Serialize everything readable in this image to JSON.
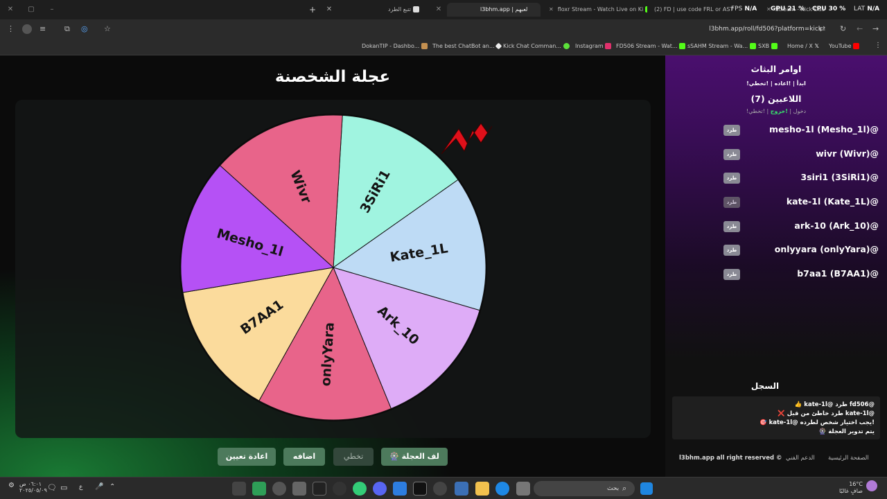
{
  "browser": {
    "tabs": [
      {
        "title": "تتبع الطرد"
      },
      {
        "title": "l3bhm.app | لعبهم"
      },
      {
        "title": "floxr Stream - Watch Live on Ki"
      },
      {
        "title": "(2) FD | use code FRL or AST"
      },
      {
        "title": "Stream - Kick Dashboard"
      }
    ],
    "perf": {
      "fps_label": "FPS",
      "fps_value": "N/A",
      "gpu": "GPU 21 %",
      "cpu": "CPU 30 %",
      "lat_label": "LAT",
      "lat_value": "N/A"
    },
    "url": "l3bhm.app/roll/fd506?platform=kick",
    "bookmarks": [
      "DokanTIP - Dashbo...",
      "The best ChatBot an...",
      "Kick Chat Comman...",
      "Instagram",
      "FD506 Stream - Wat...",
      "sSAHM Stream - Wa...",
      "SXB",
      "Home / X",
      "YouTube"
    ]
  },
  "page": {
    "title": "عجلة الشخصنة",
    "buttons": {
      "spin": "لف العجلة",
      "skip": "تخطي",
      "add": "اضافه",
      "reset": "اعادة تعيين"
    }
  },
  "wheel": {
    "segments": [
      {
        "name": "3SiRi1",
        "color": "#a0f4e0"
      },
      {
        "name": "Kate_1L",
        "color": "#bedbf5"
      },
      {
        "name": "Ark_10",
        "color": "#deacf7"
      },
      {
        "name": "onlyYara",
        "color": "#e8648a"
      },
      {
        "name": "B7AA1",
        "color": "#fbdb9c"
      },
      {
        "name": "Mesho_1l",
        "color": "#b551f5"
      },
      {
        "name": "Wivr",
        "color": "#e8648a"
      }
    ],
    "pointer_color": "#e0101a"
  },
  "sidebar": {
    "commands_title": "اوامر البثاث",
    "commands_line": "!ابدأ | !اعاده | !تخطي",
    "players_title": "اللاعبين (7)",
    "players_cmds": {
      "join": "!دخول",
      "leave": "!خروج",
      "skip": "!تخطي"
    },
    "kick_label": "طرد",
    "players": [
      {
        "name": "mesho-1l (Mesho_1l)@"
      },
      {
        "name": "wivr (Wivr)@"
      },
      {
        "name": "3siri1 (3SiRi1)@"
      },
      {
        "name": "kate-1l (Kate_1L)@"
      },
      {
        "name": "ark-10 (Ark_10)@"
      },
      {
        "name": "onlyyara (onlyYara)@"
      },
      {
        "name": "b7aa1 (B7AA1)@"
      }
    ],
    "log_title": "السجل",
    "log": [
      "👍 kate-1l@ طرد fd506@",
      "❌ طرد خاطئ من قبل kate-1l@",
      "🎯 kate-1l@ يجب اختيار شخص لطرده!",
      "🎡 يتم تدوير العجلة"
    ],
    "footer": {
      "home": "الصفحة الرئيسية",
      "support": "الدعم الفني",
      "rights": "l3bhm.app all right reserved ©"
    }
  },
  "taskbar": {
    "search": "بحث",
    "weather_temp": "16°C",
    "weather_desc": "صافٍ غالبًا",
    "time": "٠٦:٠١ ص",
    "date": "٢٠٢٥/٠٥/٠٩",
    "lang": "ع"
  }
}
